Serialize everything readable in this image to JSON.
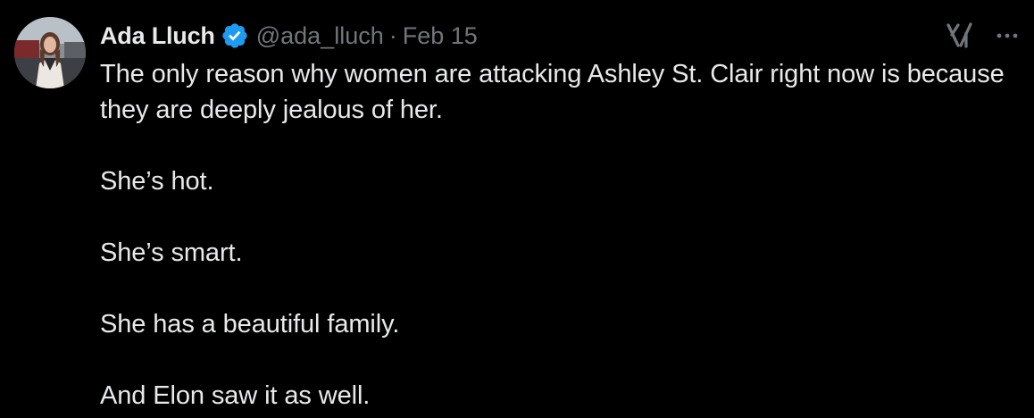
{
  "tweet": {
    "author": {
      "display_name": "Ada Lluch",
      "handle": "@ada_lluch",
      "verified": true,
      "verified_badge_color": "#1d9bf0"
    },
    "separator": "·",
    "date": "Feb 15",
    "icons": {
      "avatar": "profile-photo",
      "verified": "verified-badge-icon",
      "grok": "grok-icon",
      "more": "more-options-icon"
    },
    "paragraphs": [
      "The only reason why women are attacking Ashley St. Clair right now is because they are deeply jealous of her.",
      "She’s hot.",
      "She’s smart.",
      "She has a beautiful family.",
      "And Elon saw it as well."
    ]
  },
  "colors": {
    "background": "#000000",
    "primary_text": "#e7e9ea",
    "secondary_text": "#71767b",
    "accent": "#1d9bf0"
  }
}
